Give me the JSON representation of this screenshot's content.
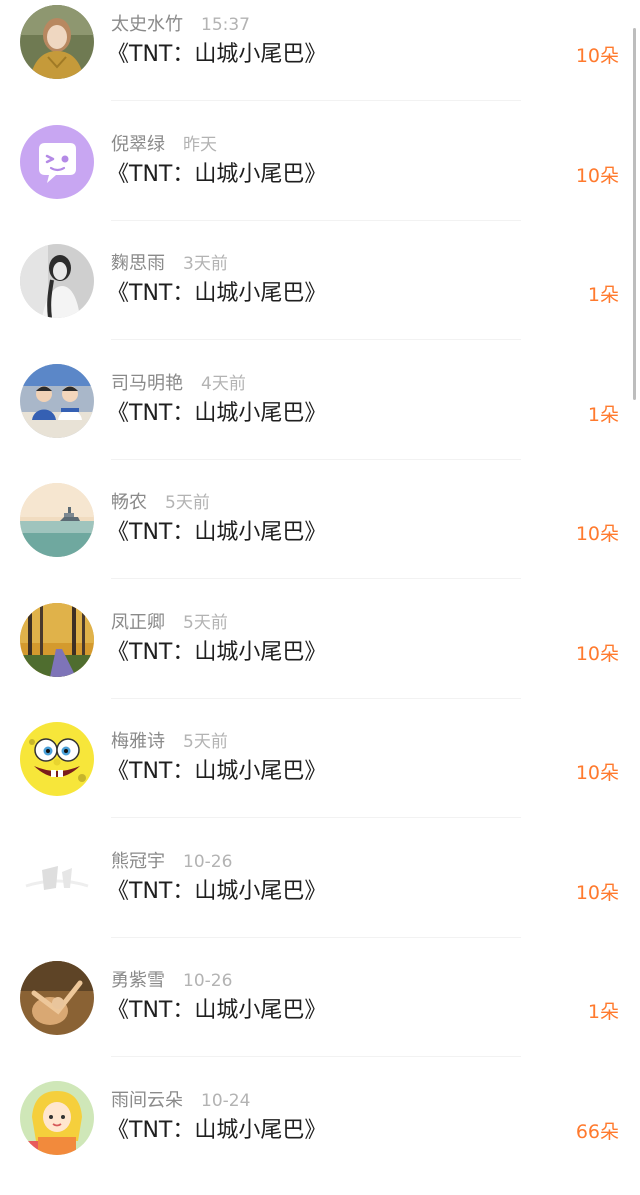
{
  "feed": {
    "items": [
      {
        "name": "太史水竹",
        "time": "15:37",
        "title": "《TNT：山城小尾巴》",
        "count": "10朵",
        "avatar_icon": "girl-sweater-photo-icon"
      },
      {
        "name": "倪翠绿",
        "time": "昨天",
        "title": "《TNT：山城小尾巴》",
        "count": "10朵",
        "avatar_icon": "wink-chat-bubble-icon"
      },
      {
        "name": "麴思雨",
        "time": "3天前",
        "title": "《TNT：山城小尾巴》",
        "count": "1朵",
        "avatar_icon": "bw-girl-portrait-icon"
      },
      {
        "name": "司马明艳",
        "time": "4天前",
        "title": "《TNT：山城小尾巴》",
        "count": "1朵",
        "avatar_icon": "classroom-students-photo-icon"
      },
      {
        "name": "畅农",
        "time": "5天前",
        "title": "《TNT：山城小尾巴》",
        "count": "10朵",
        "avatar_icon": "sea-ship-photo-icon"
      },
      {
        "name": "凤正卿",
        "time": "5天前",
        "title": "《TNT：山城小尾巴》",
        "count": "10朵",
        "avatar_icon": "forest-road-photo-icon"
      },
      {
        "name": "梅雅诗",
        "time": "5天前",
        "title": "《TNT：山城小尾巴》",
        "count": "10朵",
        "avatar_icon": "spongebob-face-icon"
      },
      {
        "name": "熊冠宇",
        "time": "10-26",
        "title": "《TNT：山城小尾巴》",
        "count": "10朵",
        "avatar_icon": "faded-sketch-icon"
      },
      {
        "name": "勇紫雪",
        "time": "10-26",
        "title": "《TNT：山城小尾巴》",
        "count": "1朵",
        "avatar_icon": "dancer-painting-icon"
      },
      {
        "name": "雨间云朵",
        "time": "10-24",
        "title": "《TNT：山城小尾巴》",
        "count": "66朵",
        "avatar_icon": "cartoon-girl-icon"
      }
    ]
  },
  "colors": {
    "accent_count": "#ff7a2e",
    "name_text": "#8a8a8a",
    "time_text": "#b3b3b3",
    "title_text": "#1f1f1f"
  }
}
